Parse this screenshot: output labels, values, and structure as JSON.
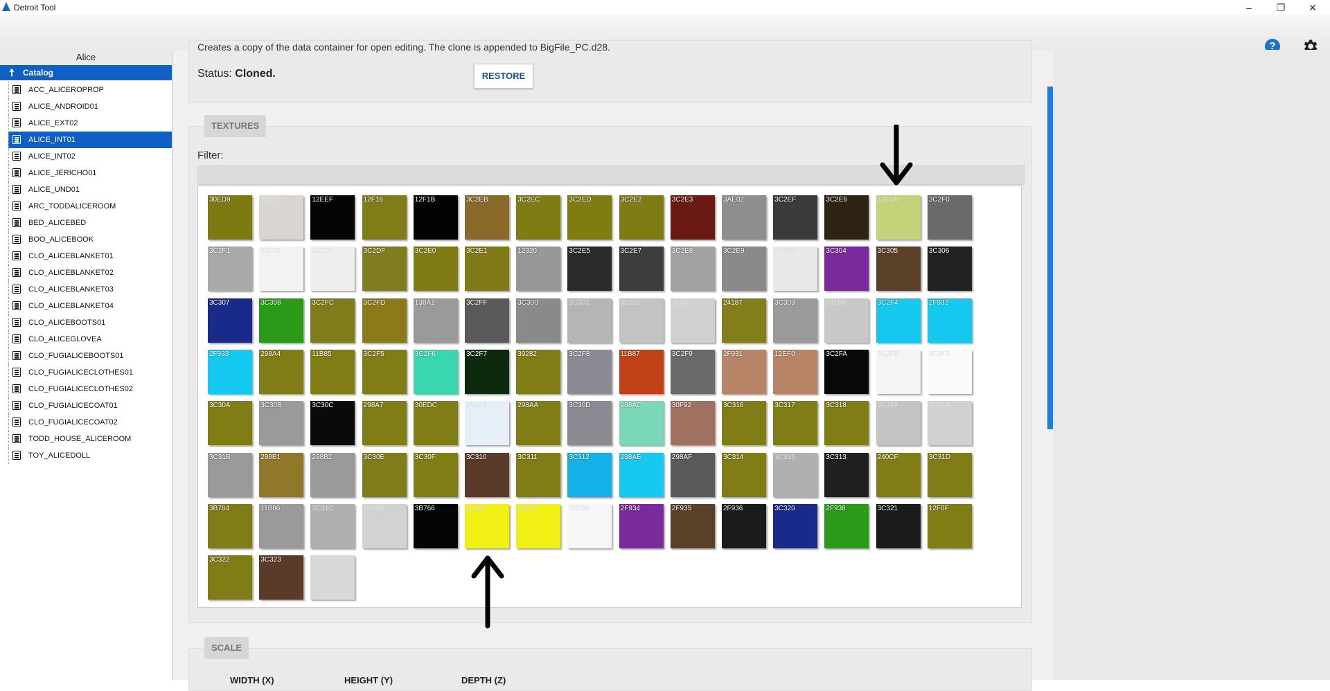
{
  "window": {
    "title": "Detroit Tool",
    "minimize": "–",
    "maximize": "❐",
    "close": "✕"
  },
  "toolbar": {
    "help_icon": "help-icon",
    "settings_icon": "gear-icon"
  },
  "sidebar": {
    "header": "Alice",
    "catalog_label": "Catalog",
    "items": [
      {
        "label": "ACC_ALICEROPROP"
      },
      {
        "label": "ALICE_ANDROID01"
      },
      {
        "label": "ALICE_EXT02"
      },
      {
        "label": "ALICE_INT01",
        "selected": true
      },
      {
        "label": "ALICE_INT02"
      },
      {
        "label": "ALICE_JERICHO01"
      },
      {
        "label": "ALICE_UND01"
      },
      {
        "label": "ARC_TODDALICEROOM"
      },
      {
        "label": "BED_ALICEBED"
      },
      {
        "label": "BOO_ALICEBOOK"
      },
      {
        "label": "CLO_ALICEBLANKET01"
      },
      {
        "label": "CLO_ALICEBLANKET02"
      },
      {
        "label": "CLO_ALICEBLANKET03"
      },
      {
        "label": "CLO_ALICEBLANKET04"
      },
      {
        "label": "CLO_ALICEBOOTS01"
      },
      {
        "label": "CLO_ALICEGLOVEA"
      },
      {
        "label": "CLO_FUGIALICEBOOTS01"
      },
      {
        "label": "CLO_FUGIALICECLOTHES01"
      },
      {
        "label": "CLO_FUGIALICECLOTHES02"
      },
      {
        "label": "CLO_FUGIALICECOAT01"
      },
      {
        "label": "CLO_FUGIALICECOAT02"
      },
      {
        "label": "TODD_HOUSE_ALICEROOM"
      },
      {
        "label": "TOY_ALICEDOLL"
      }
    ]
  },
  "clone": {
    "description": "Creates a copy of the data container for open editing. The clone is appended to BigFile_PC.d28.",
    "status_label": "Status:",
    "status_value": "Cloned.",
    "restore_label": "RESTORE"
  },
  "textures": {
    "section_title": "TEXTURES",
    "filter_label": "Filter:",
    "filter_value": "",
    "tiles": [
      {
        "id": "30ED9",
        "color": "#7d7a12"
      },
      {
        "id": "30EDA",
        "color": "#d9d6d2",
        "light": true
      },
      {
        "id": "12EEF",
        "color": "#050505"
      },
      {
        "id": "12F16",
        "color": "#7f7d18"
      },
      {
        "id": "12F1B",
        "color": "#030303"
      },
      {
        "id": "3C2EB",
        "color": "#8a6a2a"
      },
      {
        "id": "3C2EC",
        "color": "#7f7c14"
      },
      {
        "id": "3C2ED",
        "color": "#807d10"
      },
      {
        "id": "3C2E2",
        "color": "#7f7c14"
      },
      {
        "id": "3C2E3",
        "color": "#6a1a12"
      },
      {
        "id": "3AE02",
        "color": "#8e8e8e"
      },
      {
        "id": "3C2EF",
        "color": "#3a3a3a"
      },
      {
        "id": "3C2E6",
        "color": "#2e2414"
      },
      {
        "id": "12F1A",
        "color": "#c6d27a",
        "light": true
      },
      {
        "id": "3C2F0",
        "color": "#6a6a6a"
      },
      {
        "id": "3C2F1",
        "color": "#a9a9a9"
      },
      {
        "id": "12F20",
        "color": "#f2f2f2",
        "light": true
      },
      {
        "id": "3C2DE",
        "color": "#efefef",
        "light": true
      },
      {
        "id": "3C2DF",
        "color": "#807c20"
      },
      {
        "id": "3C2E0",
        "color": "#7f7c14"
      },
      {
        "id": "3C2E1",
        "color": "#807a18"
      },
      {
        "id": "12320",
        "color": "#979797"
      },
      {
        "id": "3C2E5",
        "color": "#2a2a2a"
      },
      {
        "id": "3C2E7",
        "color": "#3d3d3d"
      },
      {
        "id": "3C2E8",
        "color": "#a2a2a2"
      },
      {
        "id": "3C2E9",
        "color": "#8a8a8a"
      },
      {
        "id": "3C2EA",
        "color": "#e8e8e8",
        "light": true
      },
      {
        "id": "3C304",
        "color": "#7a2a9a"
      },
      {
        "id": "3C305",
        "color": "#5a4028"
      },
      {
        "id": "3C306",
        "color": "#222222"
      },
      {
        "id": "3C307",
        "color": "#1a2a8a"
      },
      {
        "id": "3C308",
        "color": "#2a9a18"
      },
      {
        "id": "3C2FC",
        "color": "#7f7c1c"
      },
      {
        "id": "3C2FD",
        "color": "#8a7a18"
      },
      {
        "id": "138A1",
        "color": "#9a9a9a"
      },
      {
        "id": "3C2FF",
        "color": "#5a5a5a"
      },
      {
        "id": "3C300",
        "color": "#8a8a8a"
      },
      {
        "id": "3C301",
        "color": "#b5b5b5",
        "light": true
      },
      {
        "id": "3C302",
        "color": "#c3c3c3",
        "light": true
      },
      {
        "id": "3C303",
        "color": "#d0d0d0",
        "light": true
      },
      {
        "id": "24187",
        "color": "#827f1a"
      },
      {
        "id": "3C309",
        "color": "#9a9a9a"
      },
      {
        "id": "241B8",
        "color": "#c8c8c8",
        "light": true
      },
      {
        "id": "3C2F4",
        "color": "#14c8f0"
      },
      {
        "id": "2F932",
        "color": "#14c8f0"
      },
      {
        "id": "2F933",
        "color": "#14c8f0"
      },
      {
        "id": "298A4",
        "color": "#807c16"
      },
      {
        "id": "11B85",
        "color": "#807c16"
      },
      {
        "id": "3C2F5",
        "color": "#807c16"
      },
      {
        "id": "3C2F6",
        "color": "#3ad6b0"
      },
      {
        "id": "3C2F7",
        "color": "#0e2a0e"
      },
      {
        "id": "39282",
        "color": "#807c16"
      },
      {
        "id": "3C2F8",
        "color": "#8a8a92"
      },
      {
        "id": "11B87",
        "color": "#c04018"
      },
      {
        "id": "3C2F9",
        "color": "#6a6a6a"
      },
      {
        "id": "2F931",
        "color": "#b88468"
      },
      {
        "id": "12EF0",
        "color": "#b88468"
      },
      {
        "id": "3C2FA",
        "color": "#080808"
      },
      {
        "id": "3C2FB",
        "color": "#f4f4f4",
        "light": true
      },
      {
        "id": "3C2F3",
        "color": "#fafafa",
        "light": true
      },
      {
        "id": "3C30A",
        "color": "#807c16"
      },
      {
        "id": "3C30B",
        "color": "#9a9a9a"
      },
      {
        "id": "3C30C",
        "color": "#0a0a0a"
      },
      {
        "id": "298A7",
        "color": "#807c16"
      },
      {
        "id": "30EDC",
        "color": "#807c16"
      },
      {
        "id": "298A9",
        "color": "#e6eef8",
        "light": true
      },
      {
        "id": "298AA",
        "color": "#807c16"
      },
      {
        "id": "3C30D",
        "color": "#8a8a92"
      },
      {
        "id": "298AC",
        "color": "#7ad8b8"
      },
      {
        "id": "30F92",
        "color": "#a07060"
      },
      {
        "id": "3C316",
        "color": "#807c16"
      },
      {
        "id": "3C317",
        "color": "#807c16"
      },
      {
        "id": "3C318",
        "color": "#807c16"
      },
      {
        "id": "3C319",
        "color": "#c4c4c4",
        "light": true
      },
      {
        "id": "3C31A",
        "color": "#d0d0d0",
        "light": true
      },
      {
        "id": "3C31B",
        "color": "#9a9a9a"
      },
      {
        "id": "298B1",
        "color": "#90782a"
      },
      {
        "id": "298B2",
        "color": "#9a9a9a"
      },
      {
        "id": "3C30E",
        "color": "#807c1c"
      },
      {
        "id": "3C30F",
        "color": "#807c16"
      },
      {
        "id": "3C310",
        "color": "#5a3a28"
      },
      {
        "id": "3C311",
        "color": "#807c16"
      },
      {
        "id": "3C312",
        "color": "#14b0e8"
      },
      {
        "id": "298AE",
        "color": "#14c8f0"
      },
      {
        "id": "298AF",
        "color": "#5a5a5a"
      },
      {
        "id": "3C314",
        "color": "#807c16"
      },
      {
        "id": "3C315",
        "color": "#b0b0b0",
        "light": true
      },
      {
        "id": "3C313",
        "color": "#202020"
      },
      {
        "id": "240CF",
        "color": "#807c16"
      },
      {
        "id": "3C31D",
        "color": "#807c16"
      },
      {
        "id": "3B784",
        "color": "#807c16"
      },
      {
        "id": "11B86",
        "color": "#9a9a9a"
      },
      {
        "id": "3C31C",
        "color": "#b0b0b0",
        "light": true
      },
      {
        "id": "3B785",
        "color": "#d2d2d2",
        "light": true
      },
      {
        "id": "3B766",
        "color": "#050505"
      },
      {
        "id": "3C31F",
        "color": "#f0f014",
        "light": true
      },
      {
        "id": "3B787",
        "color": "#f0f014",
        "light": true
      },
      {
        "id": "3B788",
        "color": "#f6f6f6",
        "light": true
      },
      {
        "id": "2F934",
        "color": "#7a2a9a"
      },
      {
        "id": "2F935",
        "color": "#5a4028"
      },
      {
        "id": "2F936",
        "color": "#1a1a1a"
      },
      {
        "id": "3C320",
        "color": "#1a2a8a"
      },
      {
        "id": "2F938",
        "color": "#2a9a18"
      },
      {
        "id": "3C321",
        "color": "#1a1a1a"
      },
      {
        "id": "12F0F",
        "color": "#807c16"
      },
      {
        "id": "3C322",
        "color": "#807c16"
      },
      {
        "id": "3C323",
        "color": "#5a3a28"
      },
      {
        "id": "3C324",
        "color": "#d8d8d8",
        "light": true
      }
    ]
  },
  "scale": {
    "section_title": "SCALE",
    "width_label": "WIDTH (X)",
    "height_label": "HEIGHT (Y)",
    "depth_label": "DEPTH (Z)"
  }
}
